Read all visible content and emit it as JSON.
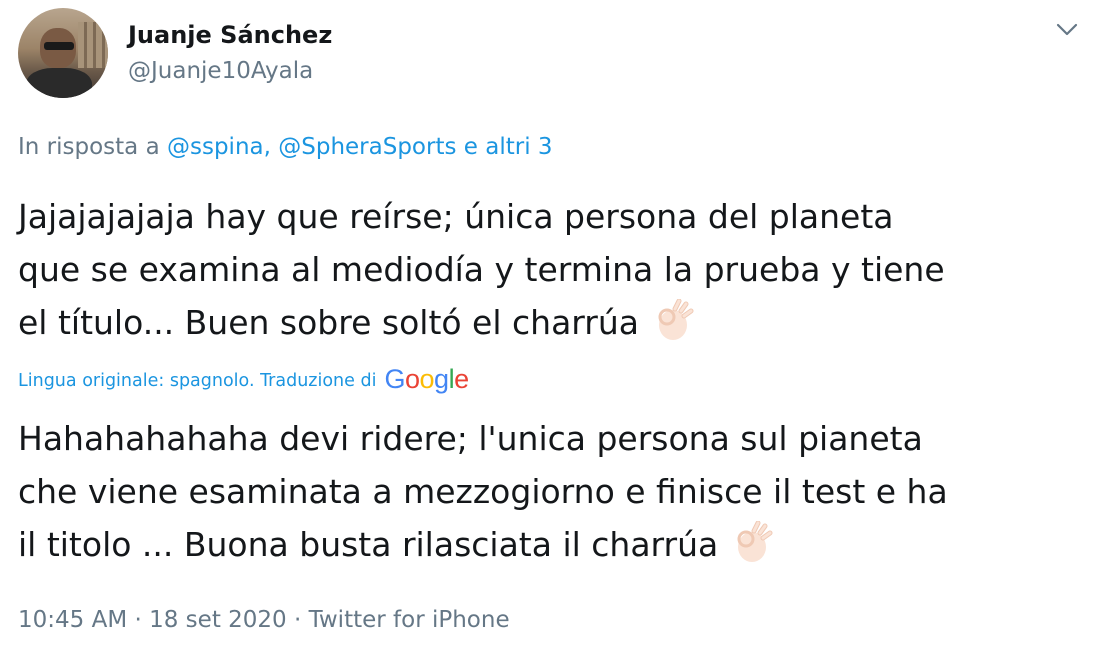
{
  "author": {
    "name": "Juanje Sánchez",
    "handle": "@Juanje10Ayala"
  },
  "reply": {
    "prefix": "In risposta a ",
    "mention1": "@sspina",
    "separator": ", ",
    "mention2": "@SpheraSports",
    "suffix": " e altri 3"
  },
  "tweet": {
    "original_lines": [
      "Jajajajajaja hay que reírse; única persona del planeta",
      "que se examina al mediodía y termina la prueba y tiene",
      "el título... Buen sobre soltó el charrúa"
    ],
    "translation_label": "Lingua originale: spagnolo. Traduzione di",
    "translation_provider_letters": [
      "G",
      "o",
      "o",
      "g",
      "l",
      "e"
    ],
    "translated_lines": [
      "Hahahahahaha devi ridere; l'unica persona sul pianeta",
      "che viene esaminata a mezzogiorno e finisce il test e ha",
      "il titolo ... Buona busta rilasciata il charrúa"
    ],
    "emoji": "ok-hand-icon"
  },
  "meta": {
    "time": "10:45 AM",
    "dot1": " · ",
    "date": "18 set 2020",
    "dot2": " · ",
    "source": "Twitter for iPhone"
  },
  "colors": {
    "text": "#14171a",
    "secondary": "#657786",
    "link": "#1b95e0"
  }
}
